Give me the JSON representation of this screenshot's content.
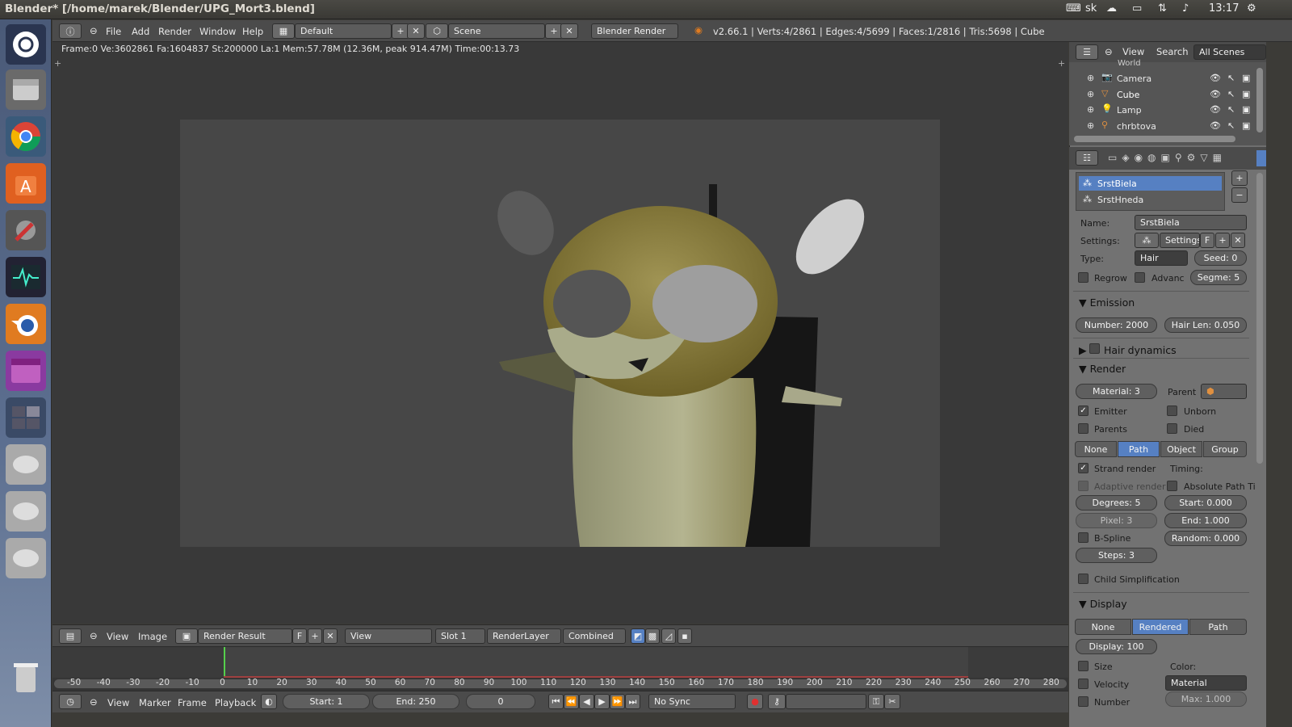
{
  "topbar": {
    "title": "Blender* [/home/marek/Blender/UPG_Mort3.blend]",
    "keyboard": "sk",
    "time": "13:17"
  },
  "launcher": {
    "items": [
      "ubuntu-icon",
      "files-icon",
      "chrome-icon",
      "software-center-icon",
      "settings-icon",
      "system-monitor-icon",
      "blender-icon",
      "app-icon",
      "workspace-icon",
      "drive-icon",
      "drive-icon",
      "drive-icon",
      "trash-icon"
    ]
  },
  "menubar": {
    "file": "File",
    "add": "Add",
    "render": "Render",
    "window": "Window",
    "help": "Help",
    "layout": "Default",
    "scene": "Scene",
    "engine": "Blender Render",
    "stats": "v2.66.1 | Verts:4/2861 | Edges:4/5699 | Faces:1/2816 | Tris:5698 | Cube"
  },
  "viewport": {
    "info": "Frame:0 Ve:3602861 Fa:1604837 St:200000 La:1 Mem:57.78M (12.36M, peak 914.47M) Time:00:13.73"
  },
  "image_header": {
    "view": "View",
    "image": "Image",
    "image_name": "Render Result",
    "f": "F",
    "view_menu": "View",
    "slot": "Slot 1",
    "layer": "RenderLayer",
    "pass": "Combined"
  },
  "timeline": {
    "ticks": [
      "-50",
      "-40",
      "-30",
      "-20",
      "-10",
      "0",
      "10",
      "20",
      "30",
      "40",
      "50",
      "60",
      "70",
      "80",
      "90",
      "100",
      "110",
      "120",
      "130",
      "140",
      "150",
      "160",
      "170",
      "180",
      "190",
      "200",
      "210",
      "220",
      "230",
      "240",
      "250",
      "260",
      "270",
      "280"
    ]
  },
  "footer": {
    "view": "View",
    "marker": "Marker",
    "frame": "Frame",
    "playback": "Playback",
    "start": "Start: 1",
    "end": "End: 250",
    "current": "0",
    "sync": "No Sync"
  },
  "outliner": {
    "view": "View",
    "search": "Search",
    "scenes": "All Scenes",
    "world": "World",
    "items": [
      "Camera",
      "Cube",
      "Lamp",
      "chrbtova"
    ]
  },
  "particles": {
    "systems": [
      "SrstBiela",
      "SrstHneda"
    ],
    "name_label": "Name:",
    "name": "SrstBiela",
    "settings_label": "Settings:",
    "settings": "Settings",
    "f": "F",
    "type_label": "Type:",
    "type": "Hair",
    "seed": "Seed: 0",
    "regrow": "Regrow",
    "advanced": "Advanc",
    "segments": "Segme: 5",
    "emission": "Emission",
    "number": "Number: 2000",
    "hair_len": "Hair Len: 0.050",
    "hair_dynamics": "Hair dynamics",
    "render": "Render",
    "material": "Material: 3",
    "parent": "Parent",
    "emitter": "Emitter",
    "unborn": "Unborn",
    "parents": "Parents",
    "died": "Died",
    "modes": [
      "None",
      "Path",
      "Object",
      "Group"
    ],
    "strand_render": "Strand render",
    "timing": "Timing:",
    "adaptive": "Adaptive render",
    "absolute": "Absolute Path Ti",
    "degrees": "Degrees: 5",
    "start": "Start: 0.000",
    "pixel": "Pixel: 3",
    "end": "End: 1.000",
    "bspline": "B-Spline",
    "random": "Random: 0.000",
    "steps": "Steps: 3",
    "child_simpl": "Child Simplification",
    "display": "Display",
    "display_modes": [
      "None",
      "Rendered",
      "Path"
    ],
    "display_amount": "Display: 100",
    "size": "Size",
    "color_label": "Color:",
    "velocity": "Velocity",
    "color": "Material",
    "number_chk": "Number",
    "max": "Max: 1.000"
  },
  "colors": {
    "accent": "#5680c2",
    "fur": "#8c7d3a"
  }
}
